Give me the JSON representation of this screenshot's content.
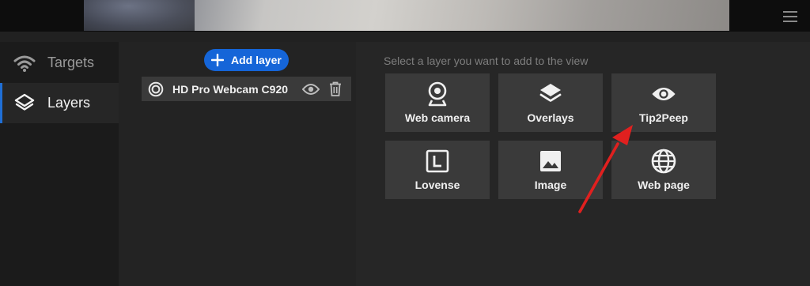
{
  "sidebar": {
    "items": [
      {
        "label": "Targets",
        "icon": "wifi-icon"
      },
      {
        "label": "Layers",
        "icon": "layers-icon"
      }
    ],
    "accent": "#1f6fd6"
  },
  "layers": {
    "add_label": "Add layer",
    "items": [
      {
        "name": "HD Pro Webcam C920",
        "icon": "webcam-source-icon"
      }
    ]
  },
  "picker": {
    "hint": "Select a layer you want to add to the view",
    "tiles": [
      {
        "label": "Web camera",
        "icon": "webcam-icon"
      },
      {
        "label": "Overlays",
        "icon": "layers-icon"
      },
      {
        "label": "Tip2Peep",
        "icon": "eye-icon"
      },
      {
        "label": "Lovense",
        "icon": "lovense-icon"
      },
      {
        "label": "Image",
        "icon": "image-icon"
      },
      {
        "label": "Web page",
        "icon": "globe-icon"
      }
    ]
  },
  "colors": {
    "primary": "#1565d8",
    "annotation": "#e0201f"
  }
}
